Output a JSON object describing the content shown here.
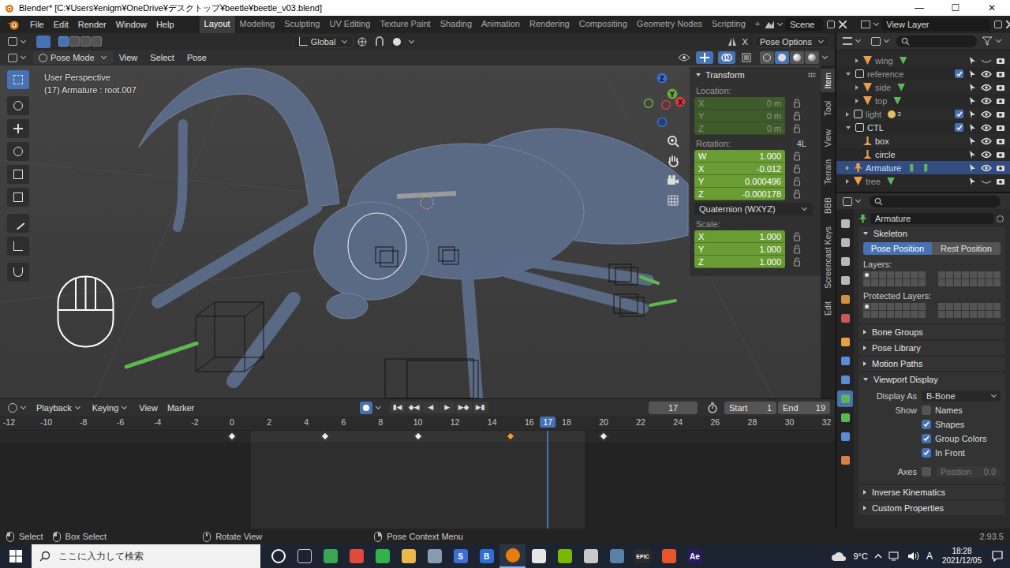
{
  "window": {
    "title": "Blender* [C:¥Users¥enigm¥OneDrive¥デスクトップ¥beetle¥beetle_v03.blend]",
    "controls": [
      "—",
      "☐",
      "✕"
    ]
  },
  "menu": [
    "File",
    "Edit",
    "Render",
    "Window",
    "Help"
  ],
  "workspaces": [
    {
      "label": "Layout",
      "selected": true
    },
    {
      "label": "Modeling",
      "selected": false
    },
    {
      "label": "Sculpting",
      "selected": false
    },
    {
      "label": "UV Editing",
      "selected": false
    },
    {
      "label": "Texture Paint",
      "selected": false
    },
    {
      "label": "Shading",
      "selected": false
    },
    {
      "label": "Animation",
      "selected": false
    },
    {
      "label": "Rendering",
      "selected": false
    },
    {
      "label": "Compositing",
      "selected": false
    },
    {
      "label": "Geometry Nodes",
      "selected": false
    },
    {
      "label": "Scripting",
      "selected": false
    }
  ],
  "add_workspace": "+",
  "scene": {
    "label": "Scene"
  },
  "view_layer": {
    "label": "View Layer"
  },
  "viewport": {
    "tool_header": {
      "modes": [
        {
          "selected": true
        },
        {
          "selected": false
        },
        {
          "selected": false
        },
        {
          "selected": false
        }
      ],
      "orientation": "Global",
      "mirror": "X",
      "options": "Pose Options"
    },
    "header": {
      "mode": "Pose Mode",
      "menus": [
        "View",
        "Select",
        "Pose"
      ],
      "shading": [
        {
          "selected": false
        },
        {
          "selected": true
        },
        {
          "selected": false
        },
        {
          "selected": false
        }
      ]
    },
    "tools": [
      {
        "selected": true
      },
      {
        "selected": false
      },
      {
        "selected": false
      },
      {
        "selected": false
      },
      {
        "selected": false
      },
      {
        "selected": false
      },
      {
        "selected": false
      },
      {
        "selected": false
      },
      {
        "selected": false
      }
    ],
    "info": [
      "User Perspective",
      "(17) Armature : root.007"
    ],
    "gizmo": {
      "x": "X",
      "y": "Y",
      "z": "Z"
    },
    "sidebar_tabs": [
      {
        "label": "Item",
        "selected": true
      },
      {
        "label": "Tool",
        "selected": false
      },
      {
        "label": "View",
        "selected": false
      },
      {
        "label": "Terrain",
        "selected": false
      },
      {
        "label": "BBB",
        "selected": false
      },
      {
        "label": "Screencast Keys",
        "selected": false
      },
      {
        "label": "Edit",
        "selected": false
      }
    ],
    "transform": {
      "title": "Transform",
      "expanded": true,
      "location": {
        "label": "Location:",
        "disabled": true,
        "fields": [
          {
            "axis": "X",
            "value": "0 m"
          },
          {
            "axis": "Y",
            "value": "0 m"
          },
          {
            "axis": "Z",
            "value": "0 m"
          }
        ]
      },
      "rotation": {
        "label": "Rotation:",
        "lock_label": "4L",
        "disabled": false,
        "fields": [
          {
            "axis": "W",
            "value": "1.000"
          },
          {
            "axis": "X",
            "value": "-0.012"
          },
          {
            "axis": "Y",
            "value": "0.000496"
          },
          {
            "axis": "Z",
            "value": "-0.000178"
          }
        ],
        "mode": "Quaternion (WXYZ)"
      },
      "scale": {
        "label": "Scale:",
        "disabled": false,
        "fields": [
          {
            "axis": "X",
            "value": "1.000"
          },
          {
            "axis": "Y",
            "value": "1.000"
          },
          {
            "axis": "Z",
            "value": "1.000"
          }
        ]
      }
    }
  },
  "timeline": {
    "menus": [
      {
        "label": "Playback",
        "dropdown": true
      },
      {
        "label": "Keying",
        "dropdown": true
      },
      {
        "label": "View",
        "dropdown": false
      },
      {
        "label": "Marker",
        "dropdown": false
      }
    ],
    "transport": [
      "▮◀",
      "◆◀",
      "◀",
      "▶",
      "▶◆",
      "▶▮"
    ],
    "current_frame": "17",
    "start_label": "Start",
    "start": "1",
    "end_label": "End",
    "end": "19",
    "ruler": [
      "-12",
      "-10",
      "-8",
      "-6",
      "-4",
      "-2",
      "0",
      "2",
      "4",
      "6",
      "8",
      "10",
      "12",
      "14",
      "16",
      "18",
      "20",
      "22",
      "24",
      "26",
      "28",
      "30",
      "32"
    ],
    "keyframes": [
      {
        "frame": 0,
        "selected": false
      },
      {
        "frame": 5,
        "selected": false
      },
      {
        "frame": 10,
        "selected": false
      },
      {
        "frame": 15,
        "selected": true
      },
      {
        "frame": 20,
        "selected": false
      }
    ]
  },
  "status_bar": {
    "items": [
      "Select",
      "Box Select",
      "Rotate View",
      "Pose Context Menu"
    ],
    "version": "2.93.5"
  },
  "outliner": {
    "rows": [
      {
        "label": "wing",
        "depth": 2,
        "kind": "object",
        "expandable": true,
        "expanded": false,
        "visible": false,
        "dimmed": true,
        "selected": false,
        "extras": 1,
        "badge": ""
      },
      {
        "label": "reference",
        "depth": 1,
        "kind": "collection",
        "expandable": true,
        "expanded": true,
        "checked": true,
        "visible": true,
        "dimmed": true,
        "selected": false,
        "extras": 0,
        "badge": ""
      },
      {
        "label": "side",
        "depth": 2,
        "kind": "object",
        "expandable": true,
        "expanded": false,
        "visible": true,
        "dimmed": true,
        "selected": false,
        "extras": 1,
        "badge": ""
      },
      {
        "label": "top",
        "depth": 2,
        "kind": "object",
        "expandable": true,
        "expanded": false,
        "visible": true,
        "dimmed": true,
        "selected": false,
        "extras": 1,
        "badge": ""
      },
      {
        "label": "light",
        "depth": 1,
        "kind": "collection",
        "expandable": true,
        "expanded": false,
        "checked": true,
        "visible": true,
        "dimmed": true,
        "selected": false,
        "extras": 1,
        "badge": "3"
      },
      {
        "label": "CTL",
        "depth": 1,
        "kind": "collection",
        "expandable": true,
        "expanded": true,
        "checked": true,
        "visible": true,
        "dimmed": false,
        "selected": false,
        "extras": 0,
        "badge": ""
      },
      {
        "label": "box",
        "depth": 2,
        "kind": "shape",
        "expandable": false,
        "expanded": false,
        "visible": true,
        "dimmed": false,
        "selected": false,
        "extras": 0,
        "badge": ""
      },
      {
        "label": "circle",
        "depth": 2,
        "kind": "shape",
        "expandable": false,
        "expanded": false,
        "visible": true,
        "dimmed": false,
        "selected": false,
        "extras": 0,
        "badge": ""
      },
      {
        "label": "Armature",
        "depth": 1,
        "kind": "armature",
        "expandable": true,
        "expanded": false,
        "visible": true,
        "dimmed": false,
        "selected": true,
        "extras": 2,
        "badge": ""
      },
      {
        "label": "tree",
        "depth": 1,
        "kind": "object",
        "expandable": true,
        "expanded": false,
        "visible": false,
        "dimmed": true,
        "selected": false,
        "extras": 1,
        "badge": ""
      }
    ]
  },
  "properties": {
    "tabs": [
      {
        "color": "#b8b8b8",
        "selected": false
      },
      {
        "color": "#b8b8b8",
        "selected": false
      },
      {
        "color": "#b8b8b8",
        "selected": false
      },
      {
        "color": "#b8b8b8",
        "selected": false
      },
      {
        "color": "#d0903e",
        "selected": false
      },
      {
        "color": "#c85a5a",
        "selected": false
      },
      {
        "color": "#e8a13c",
        "selected": false
      },
      {
        "color": "#5b8cd6",
        "selected": false
      },
      {
        "color": "#5b8cd6",
        "selected": false
      },
      {
        "color": "#5fb65a",
        "selected": true
      },
      {
        "color": "#5fb65a",
        "selected": false
      },
      {
        "color": "#5b8cd6",
        "selected": false
      },
      {
        "color": "#d8804a",
        "selected": false
      }
    ],
    "object_name": "Armature",
    "skeleton": {
      "title": "Skeleton",
      "expanded": true,
      "positions": [
        {
          "label": "Pose Position",
          "selected": true
        },
        {
          "label": "Rest Position",
          "selected": false
        }
      ],
      "layers_label": "Layers:",
      "layers": [
        true,
        false,
        false,
        false,
        false,
        false,
        false,
        false,
        false,
        false,
        false,
        false,
        false,
        false,
        false,
        false,
        false,
        false,
        false,
        false,
        false,
        false,
        false,
        false,
        false,
        false,
        false,
        false,
        false,
        false,
        false,
        false
      ],
      "protected_label": "Protected Layers:",
      "protected": [
        true,
        false,
        false,
        false,
        false,
        false,
        false,
        false,
        false,
        false,
        false,
        false,
        false,
        false,
        false,
        false,
        false,
        false,
        false,
        false,
        false,
        false,
        false,
        false,
        false,
        false,
        false,
        false,
        false,
        false,
        false,
        false
      ]
    },
    "panels_mid": [
      {
        "title": "Bone Groups",
        "expanded": false
      },
      {
        "title": "Pose Library",
        "expanded": false
      },
      {
        "title": "Motion Paths",
        "expanded": false
      }
    ],
    "viewport_display": {
      "title": "Viewport Display",
      "expanded": true,
      "display_as_label": "Display As",
      "display_as": "B-Bone",
      "show_label": "Show",
      "options": [
        {
          "label": "Names",
          "checked": false
        },
        {
          "label": "Shapes",
          "checked": true
        },
        {
          "label": "Group Colors",
          "checked": true
        },
        {
          "label": "In Front",
          "checked": true
        }
      ],
      "axes": {
        "label": "Axes",
        "checked": false,
        "position_label": "Position",
        "position_value": "0.0",
        "disabled": true
      }
    },
    "panels_end": [
      {
        "title": "Inverse Kinematics",
        "expanded": false
      },
      {
        "title": "Custom Properties",
        "expanded": false
      }
    ]
  },
  "taskbar": {
    "search": "ここに入力して検索",
    "apps": [
      {
        "glyph": "",
        "color": "#ffffff",
        "active": false
      },
      {
        "glyph": "",
        "color": "#d0d0d0",
        "active": false
      },
      {
        "glyph": "",
        "color": "#3aa655",
        "active": false
      },
      {
        "glyph": "",
        "color": "#e04a3a",
        "active": false
      },
      {
        "glyph": "",
        "color": "#2fb34a",
        "active": false
      },
      {
        "glyph": "",
        "color": "#e8b84a",
        "active": false
      },
      {
        "glyph": "",
        "color": "#8a9bb0",
        "active": false
      },
      {
        "glyph": "S",
        "color": "#3c6fd1",
        "active": false
      },
      {
        "glyph": "B",
        "color": "#2c6fd6",
        "active": false
      },
      {
        "glyph": "",
        "color": "#e87d0d",
        "active": true
      },
      {
        "glyph": "",
        "color": "#e6e6e6",
        "active": false
      },
      {
        "glyph": "",
        "color": "#76b900",
        "active": false
      },
      {
        "glyph": "",
        "color": "#c8c8c8",
        "active": false
      },
      {
        "glyph": "",
        "color": "#5a7fa8",
        "active": false
      },
      {
        "glyph": "EPIC",
        "color": "#2a2a2a",
        "active": false
      },
      {
        "glyph": "",
        "color": "#e8552a",
        "active": false
      },
      {
        "glyph": "Ae",
        "color": "#2a1a5e",
        "active": false
      }
    ],
    "weather": "9°C",
    "ime": "A",
    "time": "18:28",
    "date": "2021/12/05"
  }
}
